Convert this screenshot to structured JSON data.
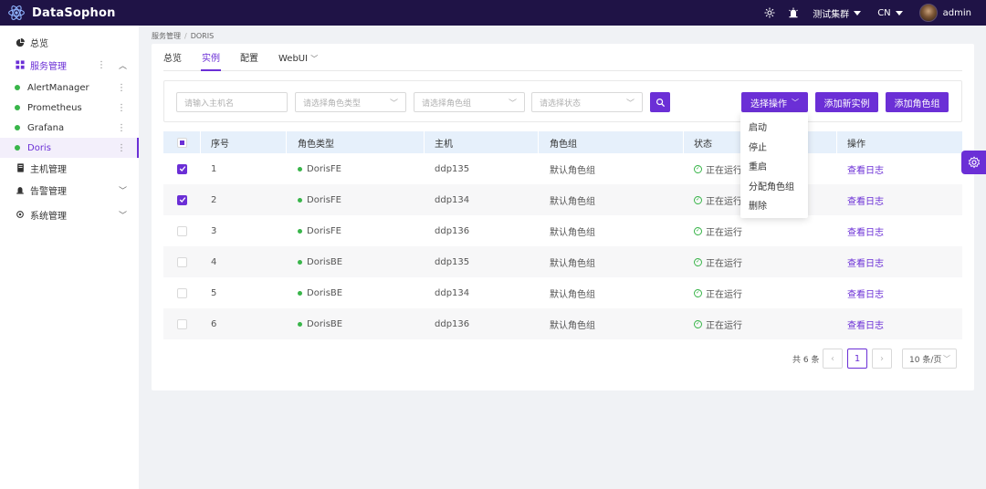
{
  "app": {
    "brand": "DataSophon"
  },
  "topbar": {
    "cluster": "测试集群",
    "lang": "CN",
    "user": "admin"
  },
  "sidebar": {
    "overview": "总览",
    "service_mgmt": "服务管理",
    "services": [
      "AlertManager",
      "Prometheus",
      "Grafana",
      "Doris"
    ],
    "host_mgmt": "主机管理",
    "alert_mgmt": "告警管理",
    "system_mgmt": "系统管理"
  },
  "breadcrumb": {
    "parent": "服务管理",
    "sep": "/",
    "current": "DORIS"
  },
  "tabs": [
    "总览",
    "实例",
    "配置",
    "WebUI"
  ],
  "filters": {
    "host_placeholder": "请输入主机名",
    "role_type_placeholder": "请选择角色类型",
    "role_group_placeholder": "请选择角色组",
    "status_placeholder": "请选择状态"
  },
  "actions": {
    "select_action": "选择操作",
    "add_instance": "添加新实例",
    "add_role_group": "添加角色组"
  },
  "dropdown": [
    "启动",
    "停止",
    "重启",
    "分配角色组",
    "删除"
  ],
  "table": {
    "headers": [
      "序号",
      "角色类型",
      "主机",
      "角色组",
      "状态",
      "操作"
    ],
    "rows": [
      {
        "checked": true,
        "no": "1",
        "role": "DorisFE",
        "host": "ddp135",
        "group": "默认角色组",
        "status": "正在运行",
        "action": "查看日志"
      },
      {
        "checked": true,
        "no": "2",
        "role": "DorisFE",
        "host": "ddp134",
        "group": "默认角色组",
        "status": "正在运行",
        "action": "查看日志"
      },
      {
        "checked": false,
        "no": "3",
        "role": "DorisFE",
        "host": "ddp136",
        "group": "默认角色组",
        "status": "正在运行",
        "action": "查看日志"
      },
      {
        "checked": false,
        "no": "4",
        "role": "DorisBE",
        "host": "ddp135",
        "group": "默认角色组",
        "status": "正在运行",
        "action": "查看日志"
      },
      {
        "checked": false,
        "no": "5",
        "role": "DorisBE",
        "host": "ddp134",
        "group": "默认角色组",
        "status": "正在运行",
        "action": "查看日志"
      },
      {
        "checked": false,
        "no": "6",
        "role": "DorisBE",
        "host": "ddp136",
        "group": "默认角色组",
        "status": "正在运行",
        "action": "查看日志"
      }
    ]
  },
  "pagination": {
    "total": "共 6 条",
    "current": "1",
    "page_size": "10 条/页"
  },
  "colors": {
    "topbar": "#1f1346",
    "accent": "#6b2fd6",
    "running": "#39b54a"
  }
}
